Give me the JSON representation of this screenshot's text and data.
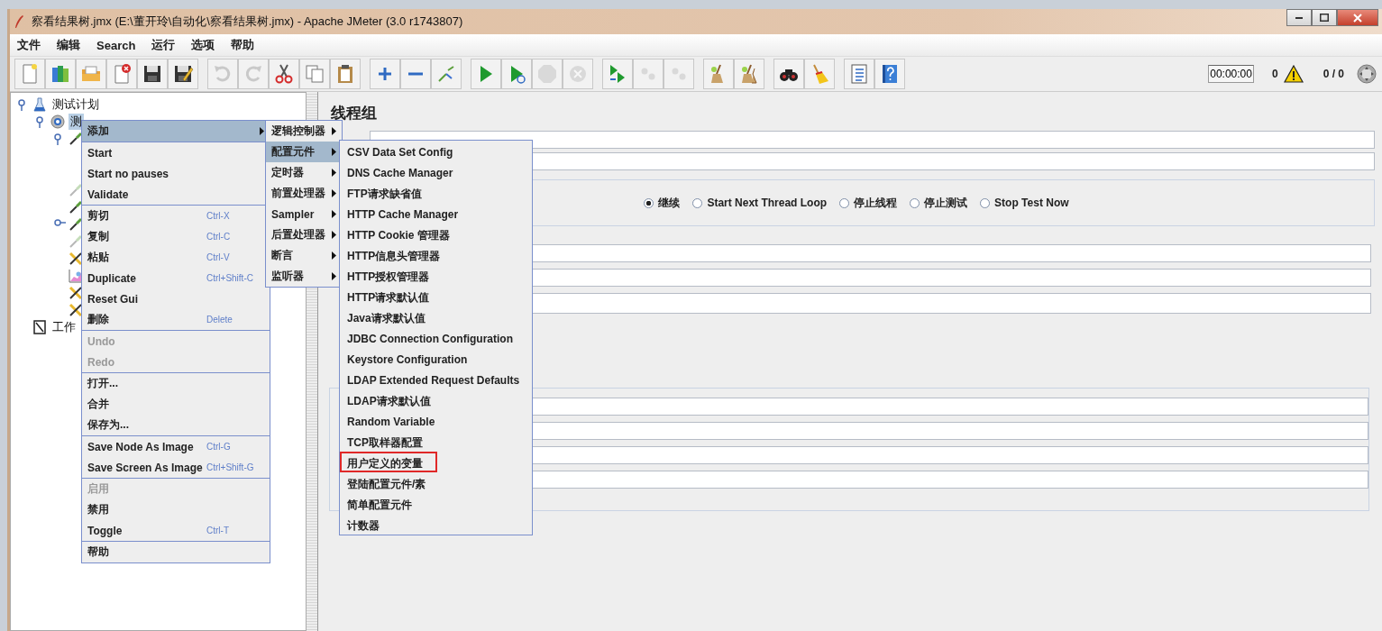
{
  "window": {
    "title": "察看结果树.jmx (E:\\董开玲\\自动化\\察看结果树.jmx) - Apache JMeter (3.0 r1743807)"
  },
  "menu_bar": [
    "文件",
    "编辑",
    "Search",
    "运行",
    "选项",
    "帮助"
  ],
  "toolbar": {
    "groups": [
      [
        {
          "kind": "new",
          "disabled": false
        },
        {
          "kind": "templates",
          "disabled": false
        },
        {
          "kind": "open",
          "disabled": false
        },
        {
          "kind": "close",
          "disabled": false
        },
        {
          "kind": "save",
          "disabled": false
        },
        {
          "kind": "save-as",
          "disabled": false
        }
      ],
      [
        {
          "kind": "undo",
          "disabled": true
        },
        {
          "kind": "redo",
          "disabled": true
        },
        {
          "kind": "cut",
          "disabled": false
        },
        {
          "kind": "copy",
          "disabled": false
        },
        {
          "kind": "paste",
          "disabled": false
        }
      ],
      [
        {
          "kind": "expand",
          "disabled": false
        },
        {
          "kind": "collapse",
          "disabled": false
        },
        {
          "kind": "toggle",
          "disabled": false
        }
      ],
      [
        {
          "kind": "start",
          "disabled": false
        },
        {
          "kind": "start-no-pauses",
          "disabled": false
        },
        {
          "kind": "stop",
          "disabled": true
        },
        {
          "kind": "shutdown",
          "disabled": true
        }
      ],
      [
        {
          "kind": "remote-start",
          "disabled": false
        },
        {
          "kind": "remote-stop",
          "disabled": true
        },
        {
          "kind": "remote-exit",
          "disabled": true
        }
      ],
      [
        {
          "kind": "clear",
          "disabled": false
        },
        {
          "kind": "clear-all",
          "disabled": false
        }
      ],
      [
        {
          "kind": "search",
          "disabled": false
        },
        {
          "kind": "reset-search",
          "disabled": false
        }
      ],
      [
        {
          "kind": "function-helper",
          "disabled": false
        },
        {
          "kind": "help",
          "disabled": false
        }
      ]
    ],
    "timer": "00:00:00",
    "error_count": "0",
    "threads": "0 / 0"
  },
  "tree": [
    {
      "label": "测试计划",
      "kind": "plan",
      "expanded": true,
      "selected": false,
      "children": [
        {
          "label": "测",
          "kind": "thread-group",
          "expanded": true,
          "selected": true,
          "children": [
            {
              "kind": "sampler",
              "expanded": true,
              "disabled": false
            },
            {
              "kind": "sampler",
              "disabled": true
            },
            {
              "kind": "sampler",
              "disabled": false
            },
            {
              "kind": "sampler",
              "expanded": false,
              "disabled": false
            },
            {
              "kind": "sampler",
              "disabled": true
            },
            {
              "kind": "tools",
              "disabled": false
            },
            {
              "kind": "graph",
              "disabled": false
            },
            {
              "kind": "tools",
              "disabled": false
            },
            {
              "kind": "tools",
              "disabled": false
            }
          ]
        }
      ]
    },
    {
      "label": "工作",
      "kind": "workbench",
      "selected": false
    }
  ],
  "context_menu": {
    "sections": [
      [
        {
          "label": "添加",
          "submenu": true,
          "selected": true,
          "disabled": false
        }
      ],
      [
        {
          "label": "Start",
          "selected": false,
          "disabled": false
        },
        {
          "label": "Start no pauses",
          "selected": false,
          "disabled": false
        },
        {
          "label": "Validate",
          "selected": false,
          "disabled": false
        }
      ],
      [
        {
          "label": "剪切",
          "shortcut": "Ctrl-X",
          "selected": false,
          "disabled": false
        },
        {
          "label": "复制",
          "shortcut": "Ctrl-C",
          "selected": false,
          "disabled": false
        },
        {
          "label": "粘贴",
          "shortcut": "Ctrl-V",
          "selected": false,
          "disabled": false
        },
        {
          "label": "Duplicate",
          "shortcut": "Ctrl+Shift-C",
          "selected": false,
          "disabled": false
        },
        {
          "label": "Reset Gui",
          "selected": false,
          "disabled": false
        },
        {
          "label": "删除",
          "shortcut": "Delete",
          "selected": false,
          "disabled": false
        }
      ],
      [
        {
          "label": "Undo",
          "selected": false,
          "disabled": true
        },
        {
          "label": "Redo",
          "selected": false,
          "disabled": true
        }
      ],
      [
        {
          "label": "打开...",
          "selected": false,
          "disabled": false
        },
        {
          "label": "合并",
          "selected": false,
          "disabled": false
        },
        {
          "label": "保存为...",
          "selected": false,
          "disabled": false
        }
      ],
      [
        {
          "label": "Save Node As Image",
          "shortcut": "Ctrl-G",
          "selected": false,
          "disabled": false
        },
        {
          "label": "Save Screen As Image",
          "shortcut": "Ctrl+Shift-G",
          "selected": false,
          "disabled": false
        }
      ],
      [
        {
          "label": "启用",
          "selected": false,
          "disabled": true
        },
        {
          "label": "禁用",
          "selected": false,
          "disabled": false
        },
        {
          "label": "Toggle",
          "shortcut": "Ctrl-T",
          "selected": false,
          "disabled": false
        }
      ],
      [
        {
          "label": "帮助",
          "selected": false,
          "disabled": false
        }
      ]
    ]
  },
  "add_submenu": [
    {
      "label": "逻辑控制器",
      "selected": false
    },
    {
      "label": "配置元件",
      "selected": true
    },
    {
      "label": "定时器",
      "selected": false
    },
    {
      "label": "前置处理器",
      "selected": false
    },
    {
      "label": "Sampler",
      "selected": false
    },
    {
      "label": "后置处理器",
      "selected": false
    },
    {
      "label": "断言",
      "selected": false
    },
    {
      "label": "监听器",
      "selected": false
    }
  ],
  "config_submenu": [
    {
      "label": "CSV Data Set Config",
      "selected": false,
      "outlined": false
    },
    {
      "label": "DNS Cache Manager",
      "selected": false,
      "outlined": false
    },
    {
      "label": "FTP请求缺省值",
      "selected": false,
      "outlined": false
    },
    {
      "label": "HTTP Cache Manager",
      "selected": false,
      "outlined": false
    },
    {
      "label": "HTTP Cookie 管理器",
      "selected": false,
      "outlined": false
    },
    {
      "label": "HTTP信息头管理器",
      "selected": false,
      "outlined": false
    },
    {
      "label": "HTTP授权管理器",
      "selected": false,
      "outlined": false
    },
    {
      "label": "HTTP请求默认值",
      "selected": false,
      "outlined": false
    },
    {
      "label": "Java请求默认值",
      "selected": false,
      "outlined": false
    },
    {
      "label": "JDBC Connection Configuration",
      "selected": false,
      "outlined": false
    },
    {
      "label": "Keystore Configuration",
      "selected": false,
      "outlined": false
    },
    {
      "label": "LDAP Extended Request Defaults",
      "selected": false,
      "outlined": false
    },
    {
      "label": "LDAP请求默认值",
      "selected": false,
      "outlined": false
    },
    {
      "label": "Random Variable",
      "selected": false,
      "outlined": false
    },
    {
      "label": "TCP取样器配置",
      "selected": false,
      "outlined": false
    },
    {
      "label": "用户定义的变量",
      "selected": false,
      "outlined": true
    },
    {
      "label": "登陆配置元件/素",
      "selected": false,
      "outlined": false
    },
    {
      "label": "简单配置元件",
      "selected": false,
      "outlined": false
    },
    {
      "label": "计数器",
      "selected": false,
      "outlined": false
    }
  ],
  "panel": {
    "title": "线程组",
    "error_actions": [
      {
        "label": "继续",
        "selected": true
      },
      {
        "label": "Start Next Thread Loop",
        "selected": false
      },
      {
        "label": "停止线程",
        "selected": false
      },
      {
        "label": "停止测试",
        "selected": false
      },
      {
        "label": "Stop Test Now",
        "selected": false
      }
    ]
  }
}
